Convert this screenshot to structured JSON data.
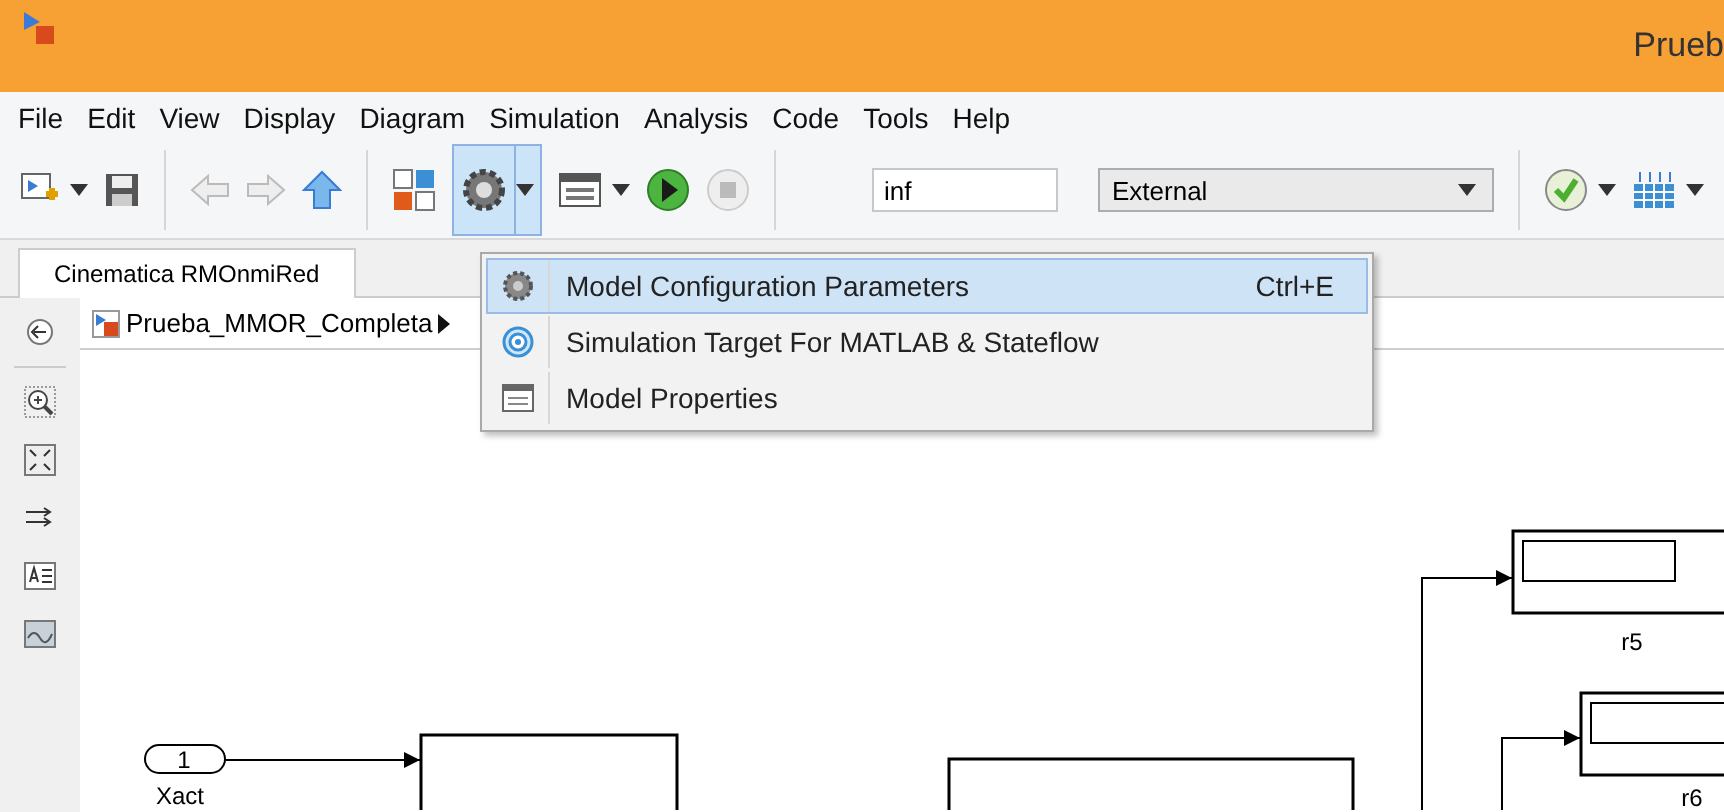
{
  "window": {
    "title": "Prueb"
  },
  "menu": [
    "File",
    "Edit",
    "View",
    "Display",
    "Diagram",
    "Simulation",
    "Analysis",
    "Code",
    "Tools",
    "Help"
  ],
  "toolbar": {
    "config_button_pressed": true,
    "stop_time": "inf",
    "sim_mode": "External"
  },
  "tabs": [
    {
      "label": "Cinematica RMOnmiRed",
      "selected": true
    }
  ],
  "breadcrumb": "Prueba_MMOR_Completa",
  "popup_menu": [
    {
      "label": "Model Configuration Parameters",
      "shortcut": "Ctrl+E",
      "selected": true
    },
    {
      "label": "Simulation Target For MATLAB & Stateflow",
      "selected": false
    },
    {
      "label": "Model Properties",
      "selected": false
    }
  ],
  "diagram": {
    "inport_number": "1",
    "inport_name": "Xact",
    "display_1": "r5",
    "display_2": "r6"
  }
}
